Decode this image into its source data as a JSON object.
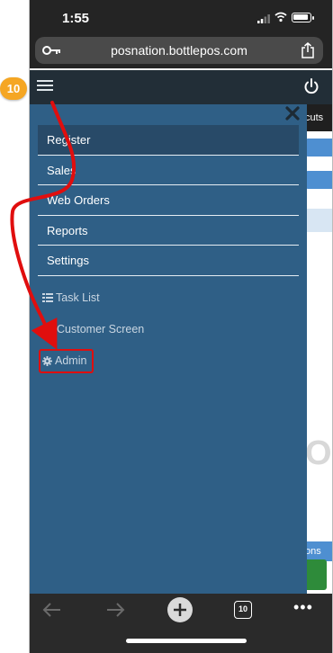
{
  "status_bar": {
    "time": "1:55"
  },
  "browser": {
    "url": "posnation.bottlepos.com",
    "tab_count": "10"
  },
  "side_menu": {
    "items": [
      {
        "label": "Register",
        "active": true
      },
      {
        "label": "Sales",
        "active": false
      },
      {
        "label": "Web Orders",
        "active": false
      },
      {
        "label": "Reports",
        "active": false
      },
      {
        "label": "Settings",
        "active": false
      }
    ],
    "secondary": {
      "task_list": "Task List",
      "customer_screen": "Customer Screen",
      "admin": "Admin"
    }
  },
  "background_page": {
    "shortcuts_label": "cuts",
    "options_label": "ons"
  },
  "annotation": {
    "step_number": "10"
  },
  "colors": {
    "nav_bar": "#222e37",
    "menu_background": "#2f5f86",
    "menu_active": "#284a68",
    "highlight": "#e00e0e",
    "step_badge": "#f5a623",
    "accent_blue": "#4e8fd1"
  },
  "icons": {
    "status": [
      "signal-icon",
      "wifi-icon",
      "battery-icon"
    ],
    "browser": [
      "key-icon",
      "share-icon"
    ],
    "nav": [
      "hamburger-icon",
      "power-icon"
    ],
    "menu": [
      "close-icon",
      "list-icon",
      "eye-icon",
      "gear-icon"
    ],
    "toolbar": [
      "back-icon",
      "forward-icon",
      "plus-icon",
      "tabs-icon",
      "more-icon"
    ]
  }
}
